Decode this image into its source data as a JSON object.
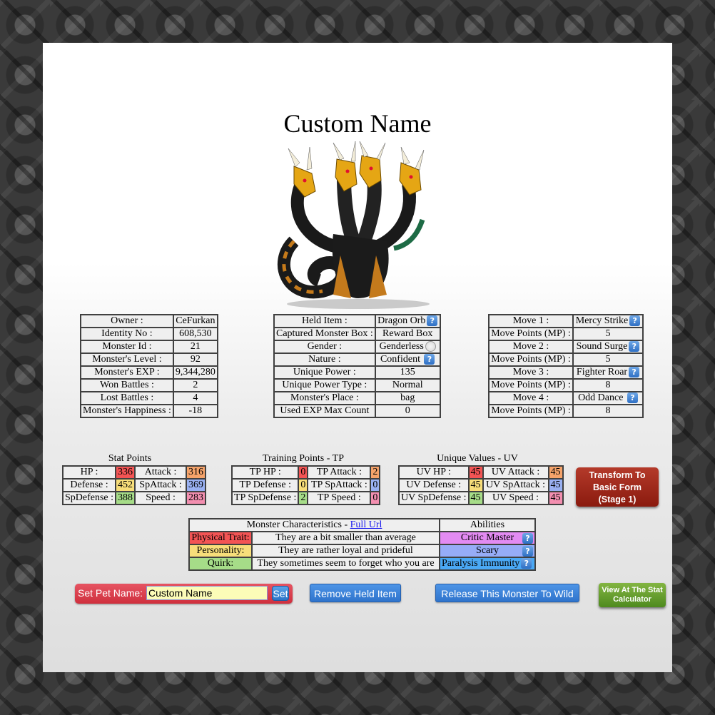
{
  "pet_name": "Custom Name",
  "monster_image": "multi-headed-dragon-hydra",
  "info_table": [
    {
      "label": "Owner :",
      "value": "CeFurkan"
    },
    {
      "label": "Identity No :",
      "value": "608,530"
    },
    {
      "label": "Monster Id :",
      "value": "21"
    },
    {
      "label": "Monster's Level :",
      "value": "92"
    },
    {
      "label": "Monster's EXP :",
      "value": "9,344,280"
    },
    {
      "label": "Won Battles :",
      "value": "2"
    },
    {
      "label": "Lost Battles :",
      "value": "4"
    },
    {
      "label": "Monster's Happiness :",
      "value": "-18"
    }
  ],
  "item_table": [
    {
      "label": "Held Item :",
      "value": "Dragon Orb",
      "icon": "help-icon"
    },
    {
      "label": "Captured Monster Box :",
      "value": "Reward Box"
    },
    {
      "label": "Gender :",
      "value": "Genderless",
      "icon": "gender-radio-icon"
    },
    {
      "label": "Nature :",
      "value": "Confident",
      "icon": "help-icon"
    },
    {
      "label": "Unique Power :",
      "value": "135"
    },
    {
      "label": "Unique Power Type :",
      "value": "Normal"
    },
    {
      "label": "Monster's Place :",
      "value": "bag"
    },
    {
      "label": "Used EXP Max Count",
      "value": "0"
    }
  ],
  "moves_table": [
    {
      "label": "Move 1 :",
      "value": "Mercy Strike",
      "icon": "help-icon"
    },
    {
      "label": "Move Points (MP) :",
      "value": "5"
    },
    {
      "label": "Move 2 :",
      "value": "Sound Surge",
      "icon": "help-icon"
    },
    {
      "label": "Move Points (MP) :",
      "value": "5"
    },
    {
      "label": "Move 3 :",
      "value": "Fighter Roar",
      "icon": "help-icon"
    },
    {
      "label": "Move Points (MP) :",
      "value": "8"
    },
    {
      "label": "Move 4 :",
      "value": "Odd Dance",
      "icon": "help-icon"
    },
    {
      "label": "Move Points (MP) :",
      "value": "8"
    }
  ],
  "stat_points": {
    "caption": "Stat Points",
    "rows": [
      [
        {
          "label": "HP :",
          "value": "336"
        },
        {
          "label": "Attack :",
          "value": "316"
        }
      ],
      [
        {
          "label": "Defense :",
          "value": "452"
        },
        {
          "label": "SpAttack :",
          "value": "369"
        }
      ],
      [
        {
          "label": "SpDefense :",
          "value": "388"
        },
        {
          "label": "Speed :",
          "value": "283"
        }
      ]
    ]
  },
  "training_points": {
    "caption": "Training Points - TP",
    "rows": [
      [
        {
          "label": "TP HP :",
          "value": "0"
        },
        {
          "label": "TP Attack :",
          "value": "2"
        }
      ],
      [
        {
          "label": "TP Defense :",
          "value": "0"
        },
        {
          "label": "TP SpAttack :",
          "value": "0"
        }
      ],
      [
        {
          "label": "TP SpDefense :",
          "value": "2"
        },
        {
          "label": "TP Speed :",
          "value": "0"
        }
      ]
    ]
  },
  "unique_values": {
    "caption": "Unique Values - UV",
    "rows": [
      [
        {
          "label": "UV HP :",
          "value": "45"
        },
        {
          "label": "UV Attack :",
          "value": "45"
        }
      ],
      [
        {
          "label": "UV Defense :",
          "value": "45"
        },
        {
          "label": "UV SpAttack :",
          "value": "45"
        }
      ],
      [
        {
          "label": "UV SpDefense :",
          "value": "45"
        },
        {
          "label": "UV Speed :",
          "value": "45"
        }
      ]
    ]
  },
  "stat_colors": {
    "hp": "#f35454",
    "attack": "#f5a36a",
    "defense": "#f8de7a",
    "spattack": "#9ab1f2",
    "spdefense": "#a6dc88",
    "speed": "#f38fb0"
  },
  "transform_button": {
    "line1": "Transform To",
    "line2": "Basic Form",
    "line3": "(Stage 1)"
  },
  "characteristics": {
    "header": "Monster Characteristics - ",
    "link": "Full Url",
    "abilities_header": "Abilities",
    "rows": [
      {
        "label": "Physical Trait:",
        "value": "They are a bit smaller than average",
        "ability": "Critic Master"
      },
      {
        "label": "Personality:",
        "value": "They are rather loyal and prideful",
        "ability": "Scary"
      },
      {
        "label": "Quirk:",
        "value": "They sometimes seem to forget who you are",
        "ability": "Paralysis Immunity"
      }
    ]
  },
  "pet_name_form": {
    "label": "Set Pet Name:",
    "value": "Custom Name",
    "button": "Set"
  },
  "buttons": {
    "remove_held_item": "Remove Held Item",
    "release": "Release This Monster To Wild",
    "stat_calc_line1": "View At The Stat",
    "stat_calc_line2": "Calculator"
  }
}
